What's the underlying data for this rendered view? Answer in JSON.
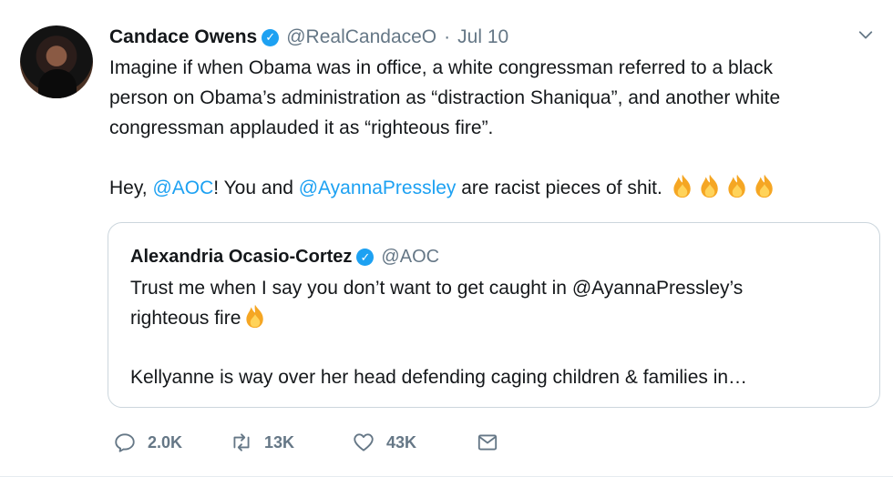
{
  "tweet": {
    "author_name": "Candace Owens",
    "handle": "@RealCandaceO",
    "separator": "·",
    "date": "Jul 10",
    "line1": "Imagine if when Obama was in office, a white congressman referred to a black",
    "line2": "person on Obama’s administration as “distraction Shaniqua”, and another white",
    "line3": "congressman applauded it as “righteous fire”.",
    "hey": "Hey, ",
    "mention_aoc": "@AOC",
    "you_and": "! You and ",
    "mention_ayanna": "@AyannaPressley",
    "closing": " are racist pieces of shit."
  },
  "quoted": {
    "author_name": "Alexandria Ocasio-Cortez",
    "handle": "@AOC",
    "line1": "Trust me when I say you don’t want to get caught in @AyannaPressley’s",
    "line2": "righteous fire",
    "line3": "Kellyanne is way over her head defending caging children & families in…"
  },
  "actions": {
    "replies": "2.0K",
    "retweets": "13K",
    "likes": "43K"
  },
  "icons": {
    "verified": "verified-badge-icon",
    "reply": "reply-icon",
    "retweet": "retweet-icon",
    "like": "heart-icon",
    "dm": "envelope-icon",
    "menu": "chevron-down-icon",
    "emoji": "fire-emoji-icon"
  },
  "colors": {
    "link": "#1da1f2",
    "muted": "#657786",
    "border": "#ccd6dd"
  }
}
